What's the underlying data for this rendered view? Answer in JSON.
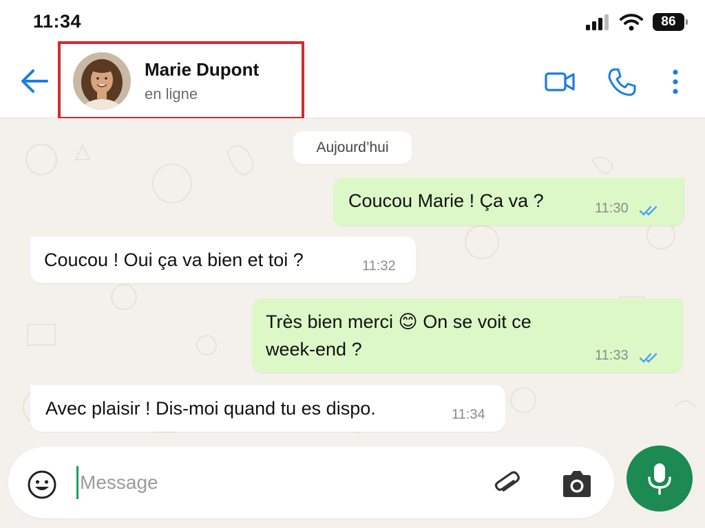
{
  "status_bar": {
    "time": "11:34",
    "battery": "86"
  },
  "header": {
    "contact_name": "Marie Dupont",
    "contact_status": "en ligne"
  },
  "chat": {
    "date_chip": "Aujourd’hui",
    "messages": [
      {
        "direction": "out",
        "text": "Coucou Marie ! Ça va ?",
        "time": "11:30",
        "read": true
      },
      {
        "direction": "in",
        "text": "Coucou ! Oui ça va bien et toi ?",
        "time": "11:32"
      },
      {
        "direction": "out",
        "text_line1": "Très bien merci 😊 On se voit ce",
        "text_line2": "week-end ?",
        "time": "11:33",
        "read": true
      },
      {
        "direction": "in",
        "text": "Avec plaisir ! Dis-moi quand tu es dispo.",
        "time": "11:34"
      }
    ]
  },
  "composer": {
    "placeholder": "Message",
    "value": ""
  },
  "colors": {
    "accent_blue": "#1a7de0",
    "outgoing_bubble": "#dcf8c7",
    "incoming_bubble": "#ffffff",
    "read_ticks": "#4aa3f0",
    "mic_button": "#1c8a52",
    "highlight_border": "#d9272e"
  },
  "icons": {
    "back": "arrow-left-icon",
    "video": "video-camera-icon",
    "phone": "phone-icon",
    "menu": "more-vertical-icon",
    "emoji": "smiley-icon",
    "attach": "paperclip-icon",
    "camera": "camera-icon",
    "mic": "microphone-icon"
  }
}
